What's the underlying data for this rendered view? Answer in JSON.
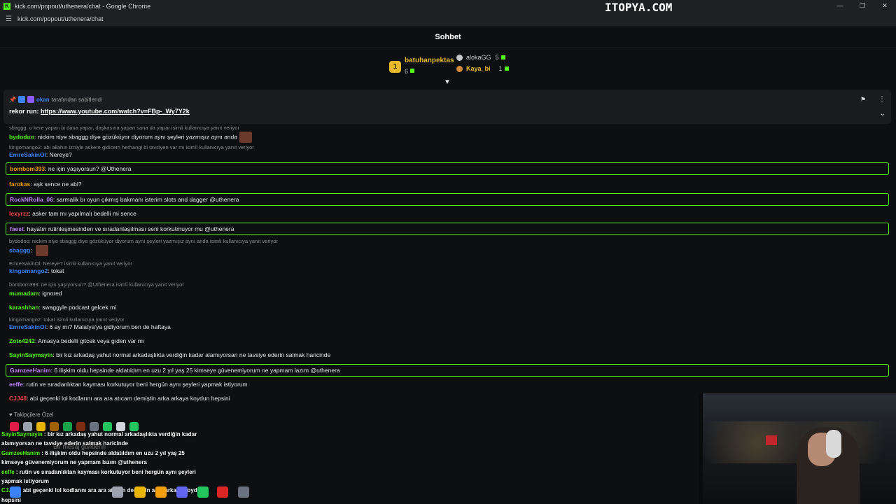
{
  "window": {
    "title": "kick.com/popout/uthenera/chat - Google Chrome",
    "url": "kick.com/popout/uthenera/chat",
    "watermark": "ITOPYA.COM",
    "favicon": "K"
  },
  "chat": {
    "title": "Sohbet",
    "followers_only": "Takipçilere Özel",
    "input_placeholder": "Bir mesaj gönderin"
  },
  "leaderboard": {
    "first": {
      "rank": "1",
      "name": "batuhanpektas",
      "count": "6"
    },
    "second": {
      "name": "alokaGG",
      "count": "5"
    },
    "third": {
      "name": "Kaya_bi",
      "count": "1"
    }
  },
  "pinned": {
    "by_user": "okan",
    "by_text": "tarafından sabitlendi",
    "prefix": "rekor run:",
    "link": "https://www.youtube.com/watch?v=FBp-_Wy7Y2k"
  },
  "colors": {
    "accent": "#53fc18",
    "background": "#0e0f11",
    "gold": "#e8b92f"
  },
  "messages": [
    {
      "type": "reply",
      "text": "sbaggg: o kere yapan bi dana yapar, daşkasına yapan sana da yapar isimli kullanıcıya yanıt veriyor"
    },
    {
      "type": "msg",
      "user": "bydodoo",
      "color": "#53fc18",
      "text": "nickim niye sbaggg diye gözüküyor diyorum aynı şeyleri yazmışız aynı anda",
      "emote": true
    },
    {
      "type": "reply",
      "text": "kingomango2: abi allahın izniyle askere gidicem herhangi bi tavsiyen var mı isimli kullanıcıya yanıt veriyor"
    },
    {
      "type": "msg",
      "user": "EmreSakinOl",
      "color": "#3b82f6",
      "text": "Nereye?"
    },
    {
      "type": "hl",
      "user": "bombom393",
      "color": "#f59e0b",
      "text": "ne için yaşıyorsun? @Uthenera"
    },
    {
      "type": "msg",
      "user": "farokas",
      "color": "#f59e0b",
      "text": "aşk sence ne abi?"
    },
    {
      "type": "hl",
      "user": "RockNRolla_06",
      "color": "#c084fc",
      "text": "sarmalik bı oyun çıkmış bakmanı isterim slots and dagger @uthenera"
    },
    {
      "type": "msg",
      "user": "lexyrzz",
      "color": "#ef4444",
      "text": "asker tam mı yapılmalı bedelli mi sence"
    },
    {
      "type": "hl",
      "user": "faest",
      "color": "#c084fc",
      "text": "hayatın rutinleşmesinden ve sıradanlaşılması seni korkutmuyor mu @uthenera"
    },
    {
      "type": "reply",
      "text": "bydodoo: nickim niye sbaggg diye gözüküyor diyorum aynı şeyleri yazmışız aynı anda isimli kullanıcıya yanıt veriyor"
    },
    {
      "type": "msg",
      "user": "sbaggg",
      "color": "#3b82f6",
      "text": "",
      "emote": true
    },
    {
      "type": "reply",
      "text": "EmreSakinOl: Nereye? isimli kullanıcıya yanıt veriyor"
    },
    {
      "type": "msg",
      "user": "kingomango2",
      "color": "#3b82f6",
      "text": "tokat"
    },
    {
      "type": "reply",
      "text": "bombom393: ne için yaşıyorsun? @Uthenera isimli kullanıcıya yanıt veriyor"
    },
    {
      "type": "msg",
      "user": "mumadam",
      "color": "#53fc18",
      "text": "ignored"
    },
    {
      "type": "msg",
      "user": "karashhan",
      "color": "#53fc18",
      "text": "swaggyle podcast gelcek mi"
    },
    {
      "type": "reply",
      "text": "kingomango2: tokat isimli kullanıcıya yanıt veriyor"
    },
    {
      "type": "msg",
      "user": "EmreSakinOl",
      "color": "#3b82f6",
      "text": "6 ay mı? Malatya'ya gidiyorum ben de haftaya"
    },
    {
      "type": "msg",
      "user": "Zote4242",
      "color": "#53fc18",
      "text": "Amasya bedelli gitcek veya gıden var mı"
    },
    {
      "type": "msg",
      "user": "SayinSaymayin",
      "color": "#53fc18",
      "text": "bir kız arkadaş yahut normal arkadaşlıkta verdiğin kadar alamıyorsan ne tavsiye ederin salmak haricinde"
    },
    {
      "type": "hl",
      "user": "GamzeeHanim",
      "color": "#c084fc",
      "text": "6 ilişkim oldu hepsinde aldatıldım en uzu 2 yıl yaş 25 kimseye güvenemiyorum ne yapmam lazım @uthenera"
    },
    {
      "type": "msg",
      "user": "eeffe",
      "color": "#c084fc",
      "text": "rutin ve sıradanlıktan kayması korkutuyor beni hergün aynı şeyleri yapmak istiyorum"
    },
    {
      "type": "msg",
      "user": "CJJ48",
      "color": "#ef4444",
      "text": "abi geçenki lol kodlarını ara ara atıcam demiştin arka arkaya koydun hepsini"
    }
  ],
  "overlay": [
    {
      "user": "SayinSaymayin",
      "text": "bir kız arkadaş yahut normal arkadaşlıkta verdiğin kadar"
    },
    {
      "user": "",
      "text": "alamıyorsan ne tavsiye ederin salmak haricinde"
    },
    {
      "user": "GamzeeHanim",
      "text": "6 ilişkim oldu hepsinde aldatıldım en uzu 2 yıl yaş 25"
    },
    {
      "user": "",
      "text": "kimseye güvenemiyorum ne yapmam lazım @uthenera"
    },
    {
      "user": "eeffe",
      "text": "rutin ve sıradanlıktan kayması korkutuyor beni hergün aynı şeyleri"
    },
    {
      "user": "",
      "text": "yapmak istiyorum"
    },
    {
      "user": "CJJ48",
      "text": "abi geçenki lol kodlarını ara ara atıcam demiştin arka arkaya koydun"
    },
    {
      "user": "",
      "text": "hepsini"
    }
  ]
}
